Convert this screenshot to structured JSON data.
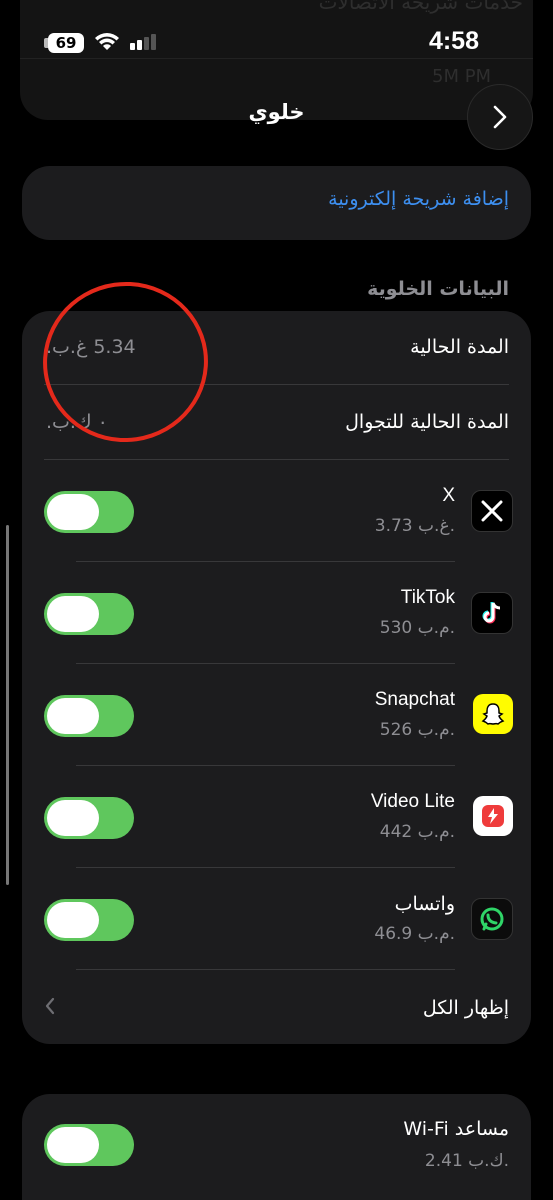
{
  "status_bar": {
    "time": "4:58",
    "battery": "69"
  },
  "ghost": {
    "line1": "خدمات شريحة الاتصالات",
    "line2": "5M PM"
  },
  "nav": {
    "title": "خلوي"
  },
  "esim": {
    "label": "إضافة شريحة إلكترونية"
  },
  "cellular_data": {
    "section_title": "البيانات الخلوية",
    "current_period_label": "المدة الحالية",
    "current_period_value": "5.34 غ.ب.",
    "roaming_label": "المدة الحالية للتجوال",
    "roaming_value": "٠ ك.ب.",
    "apps": [
      {
        "name": "X",
        "usage": "3.73 غ.ب.",
        "enabled": true,
        "icon": "x-logo-icon"
      },
      {
        "name": "TikTok",
        "usage": "530 م.ب.",
        "enabled": true,
        "icon": "tiktok-icon"
      },
      {
        "name": "Snapchat",
        "usage": "526 م.ب.",
        "enabled": true,
        "icon": "snapchat-icon"
      },
      {
        "name": "Video Lite",
        "usage": "442 م.ب.",
        "enabled": true,
        "icon": "video-lite-icon"
      },
      {
        "name": "واتساب",
        "usage": "46.9 م.ب.",
        "enabled": true,
        "icon": "whatsapp-icon"
      }
    ],
    "show_all": "إظهار الكل"
  },
  "wifi_assist": {
    "label": "مساعد Wi-Fi",
    "usage": "2.41 ك.ب.",
    "enabled": true
  },
  "colors": {
    "accent_link": "#3d8ff0",
    "toggle_on": "#5fc75d",
    "annotation": "#e4291b"
  }
}
